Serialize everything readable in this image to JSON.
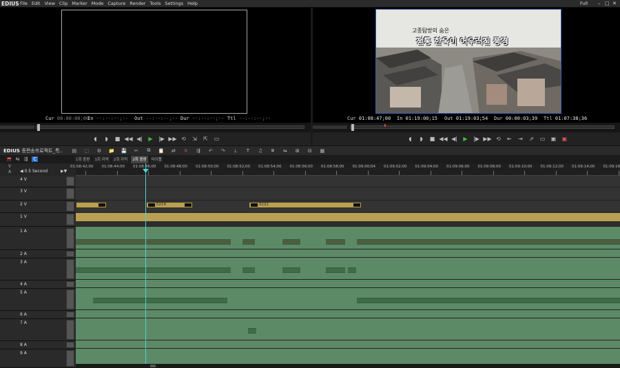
{
  "app": {
    "name": "EDIUS"
  },
  "menu": [
    "File",
    "Edit",
    "View",
    "Clip",
    "Marker",
    "Mode",
    "Capture",
    "Render",
    "Tools",
    "Settings",
    "Help"
  ],
  "window": {
    "zoom": "Full"
  },
  "player": {
    "labels": {
      "cur": "Cur",
      "in": "In",
      "out": "Out",
      "dur": "Dur",
      "ttl": "Ttl"
    },
    "cur": "00:00:00;00",
    "in": "--:--:--;--",
    "out": "--:--:--;--",
    "dur": "--:--:--;--",
    "ttl": "--:--:--;--"
  },
  "recorder": {
    "labels": {
      "cur": "Cur",
      "in": "In",
      "out": "Out",
      "dur": "Dur",
      "ttl": "Ttl"
    },
    "cur": "01:08:47;00",
    "in": "01:19:00;15",
    "out": "01:19:03;54",
    "dur": "00:00:03;39",
    "ttl": "01:07:38;36",
    "caption_top": "고종탐방의 숨은",
    "caption_main": "전통 한옥이 어우러진 풍경"
  },
  "timeline": {
    "project_title": "종편송프로젝트_특..",
    "tabs": [
      {
        "label": "1회 종편",
        "active": false
      },
      {
        "label": "1회 자막",
        "active": false
      },
      {
        "label": "2회 자막",
        "active": false
      },
      {
        "label": "2회 종편",
        "active": true
      },
      {
        "label": "타이틀",
        "active": false
      }
    ],
    "scale": "0.5 Second",
    "ruler_ticks": [
      "01:08:42;00",
      "01:08:44;00",
      "01:08:46;00",
      "01:08:48;00",
      "01:08:50;00",
      "01:08:52;00",
      "01:08:54;00",
      "01:08:56;00",
      "01:08:58;00",
      "01:09:00;04",
      "01:09:02;00",
      "01:09:04;00",
      "01:09:06;00",
      "01:09:08;00",
      "01:09:10;00",
      "01:09:12;00",
      "01:09:14;00",
      "01:09:16;"
    ],
    "tracks": [
      {
        "name": "V",
        "type": "header"
      },
      {
        "name": "A",
        "type": "header"
      },
      {
        "name": "4 V",
        "type": "v"
      },
      {
        "name": "3 V",
        "type": "v"
      },
      {
        "name": "2 V",
        "type": "v"
      },
      {
        "name": "1 V",
        "type": "v"
      },
      {
        "name": "1 A",
        "type": "a"
      },
      {
        "name": "2 A",
        "type": "a"
      },
      {
        "name": "3 A",
        "type": "a"
      },
      {
        "name": "4 A",
        "type": "a"
      },
      {
        "name": "5 A",
        "type": "a"
      },
      {
        "name": "6 A",
        "type": "a"
      },
      {
        "name": "7 A",
        "type": "a"
      },
      {
        "name": "8 A",
        "type": "a"
      },
      {
        "name": "9 A",
        "type": "a"
      }
    ],
    "clips": [
      {
        "label": "0219"
      },
      {
        "label": "0221"
      }
    ]
  },
  "colors": {
    "accent": "#3d5fb0",
    "playhead": "#4fd0d0",
    "audio_track": "#5c8a67",
    "video_clip": "#b9a053",
    "play_button": "#3cc33c"
  }
}
